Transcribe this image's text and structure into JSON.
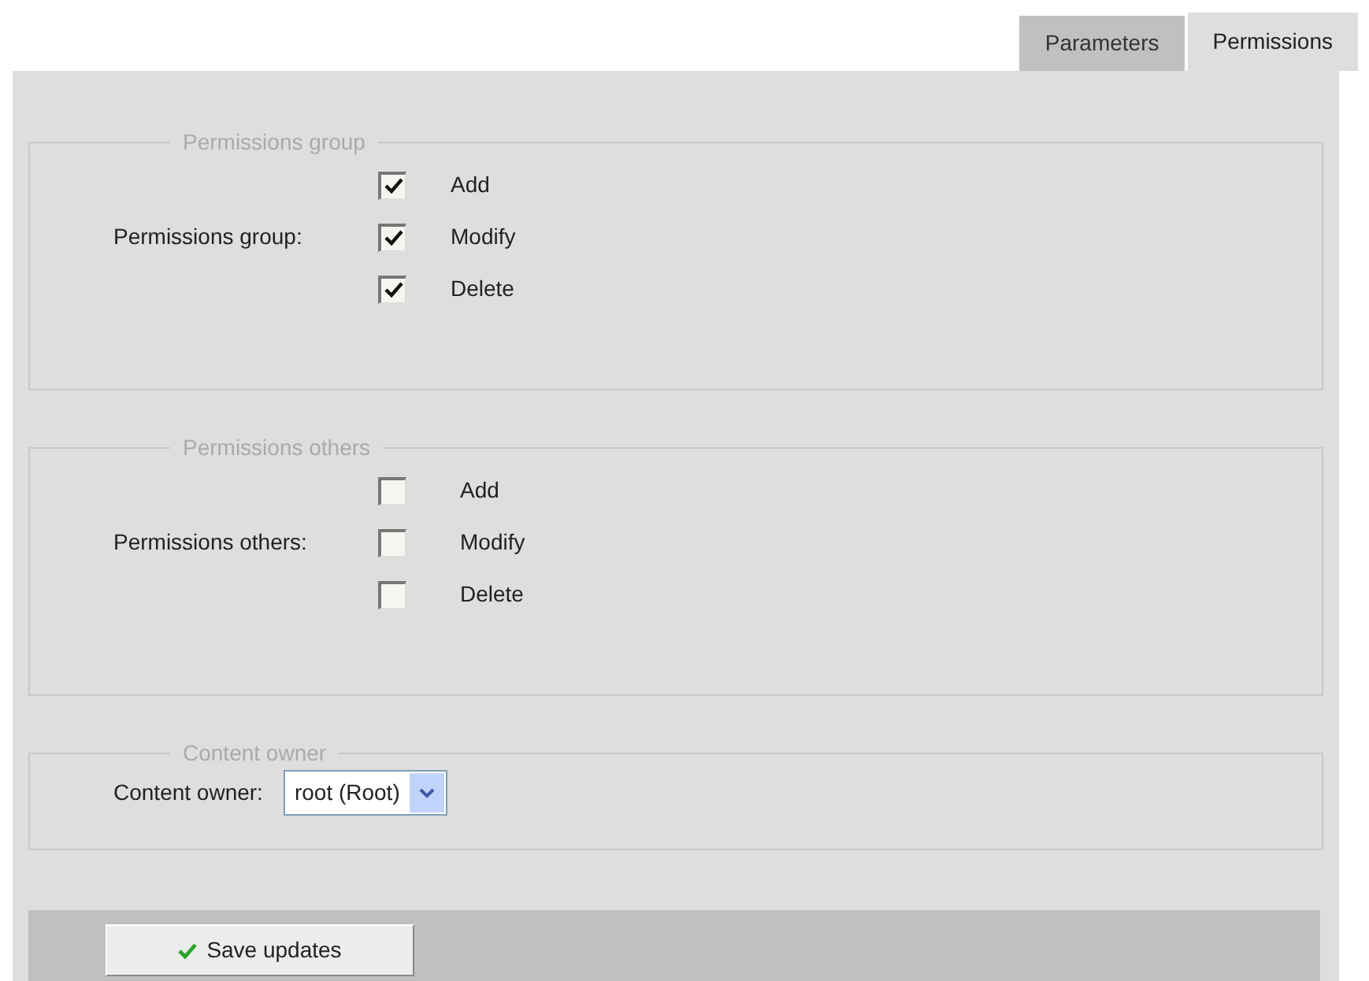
{
  "tabs": [
    {
      "label": "Parameters",
      "selected": false
    },
    {
      "label": "Permissions",
      "selected": true
    }
  ],
  "groups": [
    {
      "legend": "Permissions group",
      "label": "Permissions group:",
      "options": [
        {
          "label": "Add",
          "checked": true
        },
        {
          "label": "Modify",
          "checked": true
        },
        {
          "label": "Delete",
          "checked": true
        }
      ]
    },
    {
      "legend": "Permissions others",
      "label": "Permissions others:",
      "options": [
        {
          "label": "Add",
          "checked": false
        },
        {
          "label": "Modify",
          "checked": false
        },
        {
          "label": "Delete",
          "checked": false
        }
      ]
    }
  ],
  "owner": {
    "legend": "Content owner",
    "label": "Content owner:",
    "value": "root (Root)"
  },
  "save_button": "Save updates"
}
